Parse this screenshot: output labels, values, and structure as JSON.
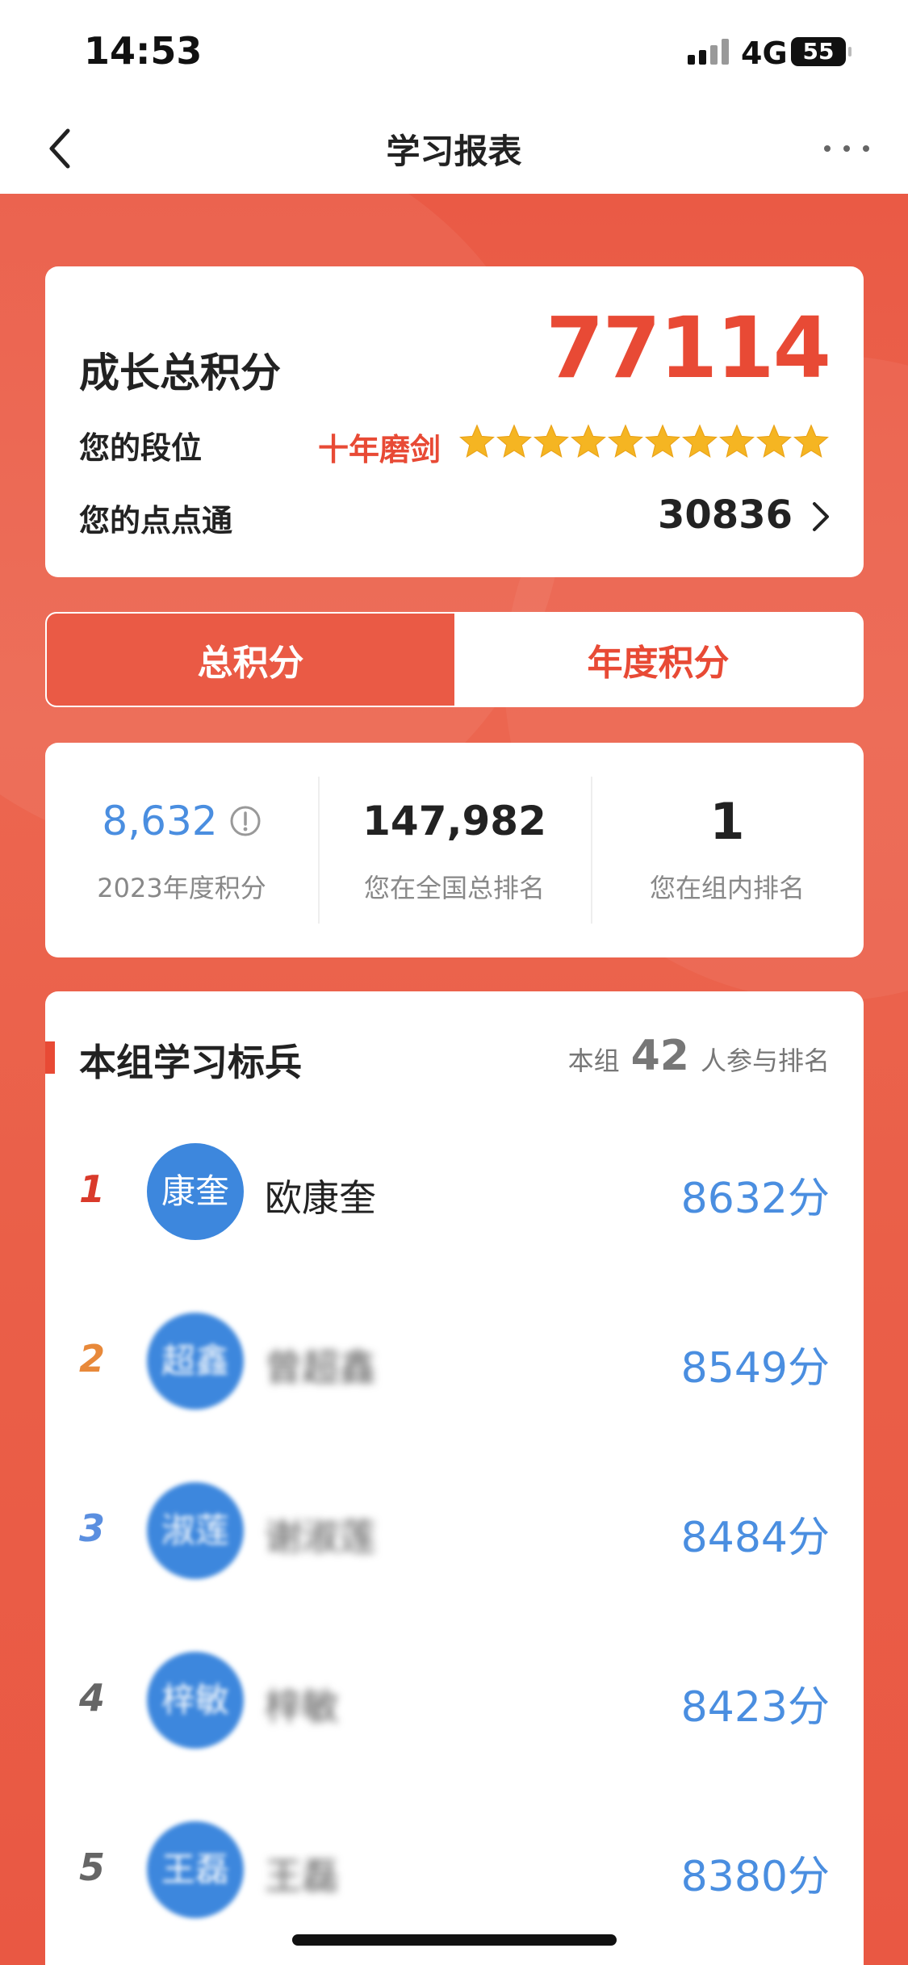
{
  "status_bar": {
    "time": "14:53",
    "network": "4G",
    "battery": "55"
  },
  "nav": {
    "title": "学习报表"
  },
  "score_card": {
    "title": "成长总积分",
    "total": "77114",
    "rank_label": "您的段位",
    "rank_name": "十年磨剑",
    "stars": 10,
    "dd_label": "您的点点通",
    "dd_value": "30836"
  },
  "tabs": [
    {
      "label": "总积分",
      "active": true
    },
    {
      "label": "年度积分",
      "active": false
    }
  ],
  "stats": [
    {
      "value": "8,632",
      "label": "2023年度积分"
    },
    {
      "value": "147,982",
      "label": "您在全国总排名"
    },
    {
      "value": "1",
      "label": "您在组内排名"
    }
  ],
  "leaderboard": {
    "title": "本组学习标兵",
    "count_prefix": "本组",
    "count": "42",
    "count_suffix": "人参与排名",
    "rows": [
      {
        "rank": "1",
        "avatar": "康奎",
        "name": "欧康奎",
        "score": "8632分",
        "rank_color": "#d93a2b"
      },
      {
        "rank": "2",
        "avatar": "超鑫",
        "name": "曾超鑫",
        "score": "8549分",
        "rank_color": "#e8893a"
      },
      {
        "rank": "3",
        "avatar": "淑莲",
        "name": "谢淑莲",
        "score": "8484分",
        "rank_color": "#5b8fe0"
      },
      {
        "rank": "4",
        "avatar": "梓敏",
        "name": "梓敏",
        "score": "8423分",
        "rank_color": "#666666"
      },
      {
        "rank": "5",
        "avatar": "王磊",
        "name": "王磊",
        "score": "8380分",
        "rank_color": "#666666"
      }
    ]
  }
}
